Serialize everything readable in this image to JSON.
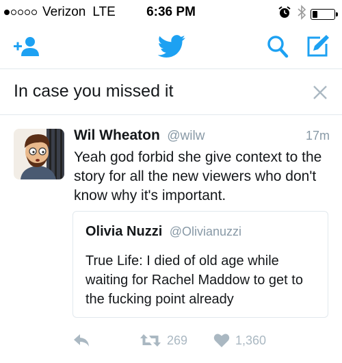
{
  "status_bar": {
    "carrier": "Verizon",
    "network": "LTE",
    "time": "6:36 PM",
    "signal_bars": 1,
    "signal_total": 5,
    "battery_level": 0.25,
    "icons": [
      "alarm-icon",
      "bluetooth-icon",
      "battery-icon"
    ]
  },
  "nav": {
    "icons": [
      "add-user-icon",
      "twitter-bird-logo",
      "search-icon",
      "compose-icon"
    ],
    "accent_color": "#1da1f2"
  },
  "section": {
    "title": "In case you missed it",
    "close_icon": "close-icon"
  },
  "tweet": {
    "author_name": "Wil Wheaton",
    "author_handle": "@wilw",
    "time": "17m",
    "text": "Yeah god forbid she give context to the story for all the new viewers who don't know why it's important.",
    "quote": {
      "author_name": "Olivia Nuzzi",
      "author_handle": "@Olivianuzzi",
      "text": "True Life: I died of old age while waiting for Rachel Maddow to get to the fucking point already"
    },
    "actions": {
      "reply_icon": "reply-icon",
      "retweet_icon": "retweet-icon",
      "retweet_count": "269",
      "like_icon": "heart-icon",
      "like_count": "1,360"
    }
  },
  "colors": {
    "text": "#14171a",
    "muted": "#8899a6",
    "action": "#aab8c2",
    "divider": "#e1e8ed"
  }
}
